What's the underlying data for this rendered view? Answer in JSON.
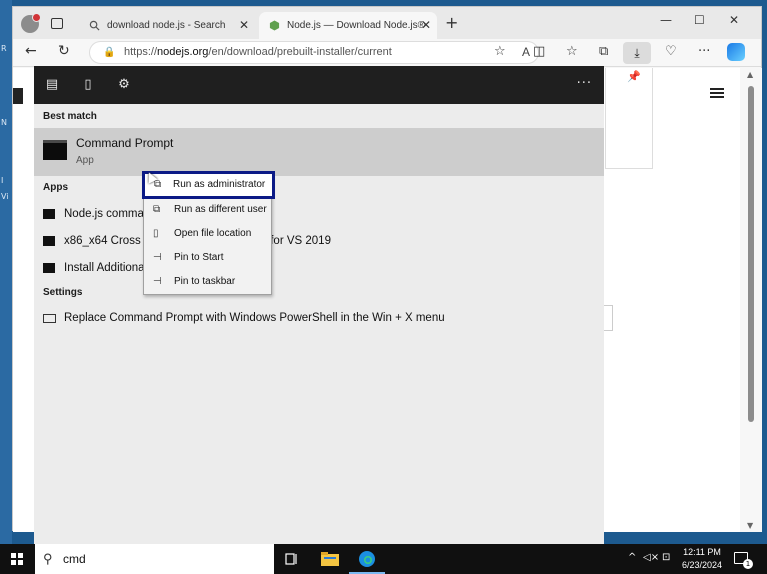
{
  "desktop": {
    "labels": [
      "R",
      "N",
      "I",
      "Vi"
    ]
  },
  "browser": {
    "tabs": [
      {
        "title": "download node.js - Search",
        "active": false
      },
      {
        "title": "Node.js — Download Node.js®",
        "active": true
      }
    ],
    "new_tab": "+",
    "window_controls": {
      "minimize": "—",
      "maximize": "☐",
      "close": "✕"
    },
    "url_prefix": "https://",
    "url_host": "nodejs.org",
    "url_path": "/en/download/prebuilt-installer/current"
  },
  "start_menu": {
    "best_match_heading": "Best match",
    "best_match": {
      "name": "Command Prompt",
      "type": "App"
    },
    "apps_heading": "Apps",
    "apps": [
      "Node.js command prompt",
      "x86_x64 Cross Tools Command Prompt for VS 2019",
      "Install Additional Tools for Node.js"
    ],
    "settings_heading": "Settings",
    "settings": [
      "Replace Command Prompt with Windows PowerShell in the Win + X menu"
    ],
    "more": "···"
  },
  "context_menu": {
    "items": [
      {
        "label": "Run as administrator",
        "icon": "shield-run-icon",
        "highlighted": true
      },
      {
        "label": "Run as different user",
        "icon": "user-run-icon",
        "highlighted": false
      },
      {
        "label": "Open file location",
        "icon": "file-location-icon",
        "highlighted": false
      },
      {
        "label": "Pin to Start",
        "icon": "pin-icon",
        "highlighted": false
      },
      {
        "label": "Pin to taskbar",
        "icon": "pin-icon",
        "highlighted": false
      }
    ]
  },
  "taskbar": {
    "search_value": "cmd",
    "time": "12:11 PM",
    "date": "6/23/2024",
    "notification_count": "1"
  },
  "colors": {
    "highlight_border": "#0b1a86",
    "start_header": "#1f1f1f",
    "taskbar": "#101010"
  }
}
